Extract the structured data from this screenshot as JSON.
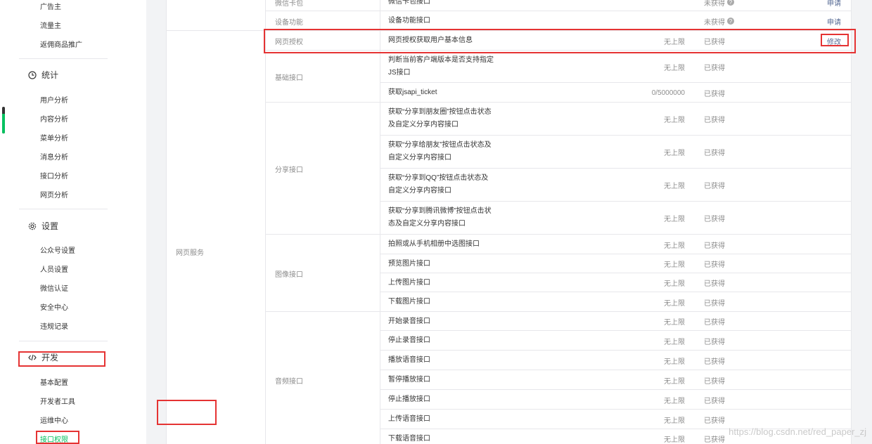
{
  "sidebar": {
    "items_top": [
      {
        "label": "广告主"
      },
      {
        "label": "流量主"
      },
      {
        "label": "返佣商品推广"
      }
    ],
    "stats": {
      "title": "统计",
      "items": [
        {
          "label": "用户分析"
        },
        {
          "label": "内容分析"
        },
        {
          "label": "菜单分析"
        },
        {
          "label": "消息分析"
        },
        {
          "label": "接口分析"
        },
        {
          "label": "网页分析"
        }
      ]
    },
    "settings": {
      "title": "设置",
      "items": [
        {
          "label": "公众号设置"
        },
        {
          "label": "人员设置"
        },
        {
          "label": "微信认证"
        },
        {
          "label": "安全中心"
        },
        {
          "label": "违规记录"
        }
      ]
    },
    "dev": {
      "title": "开发",
      "items": [
        {
          "label": "基本配置"
        },
        {
          "label": "开发者工具"
        },
        {
          "label": "运维中心"
        },
        {
          "label": "接口权限"
        }
      ]
    }
  },
  "table": {
    "category": "网页服务",
    "top_rows": [
      {
        "group": "微信卡包",
        "name": "微信卡包接口",
        "limit": "",
        "status": "未获得",
        "op": "申请"
      },
      {
        "group": "设备功能",
        "name": "设备功能接口",
        "limit": "",
        "status": "未获得",
        "op": "申请"
      }
    ],
    "groups": {
      "auth": "网页授权",
      "basic": "基础接口",
      "share": "分享接口",
      "image": "图像接口",
      "audio": "音频接口"
    },
    "rows": [
      {
        "name": "网页授权获取用户基本信息",
        "limit": "无上限",
        "status": "已获得",
        "op": "修改"
      },
      {
        "name": "判断当前客户端版本是否支持指定JS接口",
        "limit": "无上限",
        "status": "已获得",
        "op": ""
      },
      {
        "name": "获取jsapi_ticket",
        "limit": "0/5000000",
        "status": "已获得",
        "op": ""
      },
      {
        "name": "获取“分享到朋友圈”按钮点击状态及自定义分享内容接口",
        "limit": "无上限",
        "status": "已获得",
        "op": ""
      },
      {
        "name": "获取“分享给朋友”按钮点击状态及自定义分享内容接口",
        "limit": "无上限",
        "status": "已获得",
        "op": ""
      },
      {
        "name": "获取“分享到QQ”按钮点击状态及自定义分享内容接口",
        "limit": "无上限",
        "status": "已获得",
        "op": ""
      },
      {
        "name": "获取“分享到腾讯微博”按钮点击状态及自定义分享内容接口",
        "limit": "无上限",
        "status": "已获得",
        "op": ""
      },
      {
        "name": "拍照或从手机相册中选图接口",
        "limit": "无上限",
        "status": "已获得",
        "op": ""
      },
      {
        "name": "预览图片接口",
        "limit": "无上限",
        "status": "已获得",
        "op": ""
      },
      {
        "name": "上传图片接口",
        "limit": "无上限",
        "status": "已获得",
        "op": ""
      },
      {
        "name": "下载图片接口",
        "limit": "无上限",
        "status": "已获得",
        "op": ""
      },
      {
        "name": "开始录音接口",
        "limit": "无上限",
        "status": "已获得",
        "op": ""
      },
      {
        "name": "停止录音接口",
        "limit": "无上限",
        "status": "已获得",
        "op": ""
      },
      {
        "name": "播放语音接口",
        "limit": "无上限",
        "status": "已获得",
        "op": ""
      },
      {
        "name": "暂停播放接口",
        "limit": "无上限",
        "status": "已获得",
        "op": ""
      },
      {
        "name": "停止播放接口",
        "limit": "无上限",
        "status": "已获得",
        "op": ""
      },
      {
        "name": "上传语音接口",
        "limit": "无上限",
        "status": "已获得",
        "op": ""
      },
      {
        "name": "下载语音接口",
        "limit": "无上限",
        "status": "已获得",
        "op": ""
      }
    ]
  },
  "icons": {
    "stats": "clock-icon",
    "settings": "gear-icon",
    "dev": "code-icon",
    "help": "question-icon"
  },
  "colors": {
    "accent": "#07c160",
    "link": "#576b95",
    "highlight": "#e53333"
  },
  "watermark": "https://blog.csdn.net/red_paper_zj"
}
